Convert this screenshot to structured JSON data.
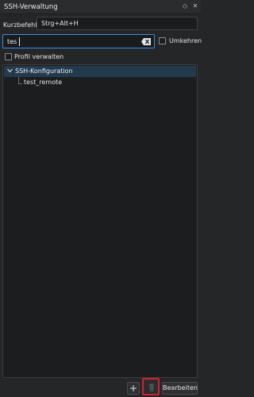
{
  "window": {
    "title": "SSH-Verwaltung"
  },
  "shortcut": {
    "label": "Kurzbefehl",
    "value": "Strg+Alt+H"
  },
  "search": {
    "value": "tes"
  },
  "options": {
    "invert_label": "Umkehren",
    "manage_profile_label": "Profil verwalten"
  },
  "tree": {
    "root_label": "SSH-Konfiguration",
    "children": [
      {
        "label": "test_remote"
      }
    ]
  },
  "buttons": {
    "add_label": "+",
    "edit_label": "Bearbeiten"
  },
  "colors": {
    "selection": "#233a4d",
    "focus": "#3d8ee6",
    "highlight": "#d3202f"
  },
  "icons": {
    "float": "diamond-icon",
    "close": "close-icon",
    "clear": "backspace-clear-icon",
    "expand": "chevron-down-icon",
    "delete": "trash-icon"
  }
}
